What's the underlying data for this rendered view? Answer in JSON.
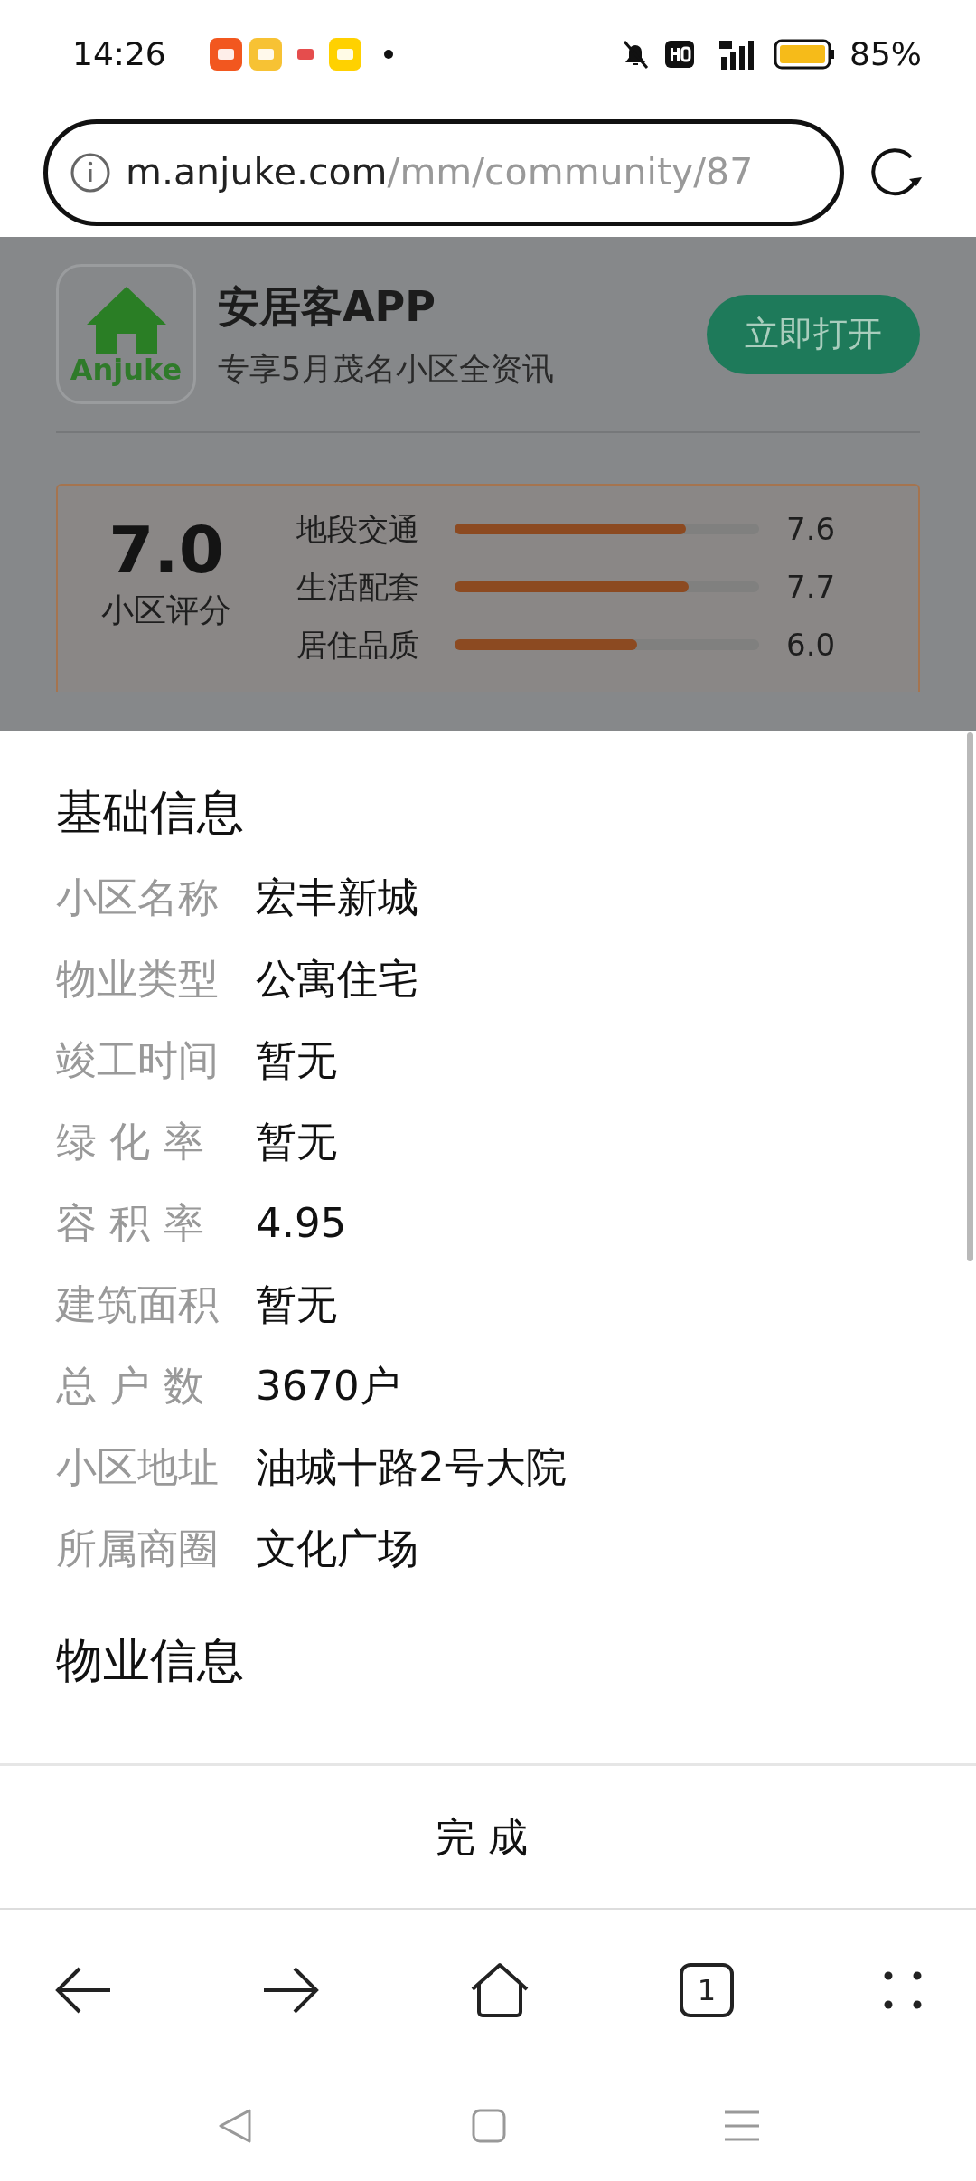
{
  "status_bar": {
    "time": "14:26",
    "battery": "85%"
  },
  "address_bar": {
    "domain": "m.anjuke.com",
    "path": "/mm/community/87"
  },
  "app_banner": {
    "logo_text": "Anjuke",
    "app_name": "安居客APP",
    "tagline": "专享5月茂名小区全资讯",
    "open_button": "立即打开"
  },
  "rating": {
    "score": "7.0",
    "score_label": "小区评分",
    "items": [
      {
        "label": "地段交通",
        "level": 0.76,
        "value": "7.6"
      },
      {
        "label": "生活配套",
        "level": 0.77,
        "value": "7.7"
      },
      {
        "label": "居住品质",
        "level": 0.6,
        "value": "6.0"
      }
    ]
  },
  "sections": [
    {
      "title": "基础信息",
      "rows": [
        {
          "label": "小区名称",
          "value": "宏丰新城"
        },
        {
          "label": "物业类型",
          "value": "公寓住宅"
        },
        {
          "label": "竣工时间",
          "value": "暂无"
        },
        {
          "label": "绿 化 率",
          "value": "暂无"
        },
        {
          "label": "容 积 率",
          "value": "4.95"
        },
        {
          "label": "建筑面积",
          "value": "暂无"
        },
        {
          "label": "总 户 数",
          "value": "3670户"
        },
        {
          "label": "小区地址",
          "value": "油城十路2号大院"
        },
        {
          "label": "所属商圈",
          "value": "文化广场"
        }
      ]
    },
    {
      "title": "物业信息"
    }
  ],
  "done_button": "完成",
  "toolbar": {
    "tab_count": "1"
  }
}
